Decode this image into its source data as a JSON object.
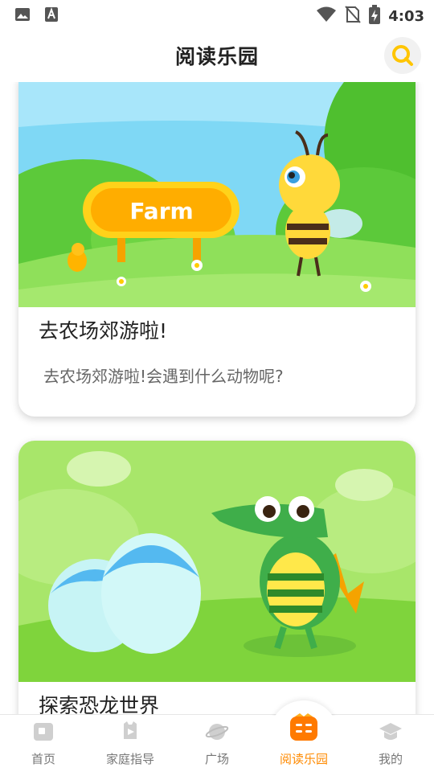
{
  "status_bar": {
    "time": "4:03",
    "left_icons": [
      "gallery-icon",
      "text-a-icon"
    ],
    "right_icons": [
      "wifi-icon",
      "no-sim-icon",
      "battery-charging-icon"
    ]
  },
  "header": {
    "title": "阅读乐园",
    "search_icon": "search-icon",
    "accent": "#ffc500"
  },
  "cards": [
    {
      "image_sign": "Farm",
      "title": "去农场郊游啦!",
      "description": "去农场郊游啦!会遇到什么动物呢?"
    },
    {
      "title": "探索恐龙世界"
    }
  ],
  "bottom_nav": {
    "active_color": "#ff8a00",
    "items": [
      {
        "label": "首页",
        "icon": "home-icon"
      },
      {
        "label": "家庭指导",
        "icon": "family-guide-icon"
      },
      {
        "label": "广场",
        "icon": "planet-icon"
      },
      {
        "label": "阅读乐园",
        "icon": "book-icon",
        "active": true
      },
      {
        "label": "我的",
        "icon": "graduation-cap-icon"
      }
    ]
  }
}
